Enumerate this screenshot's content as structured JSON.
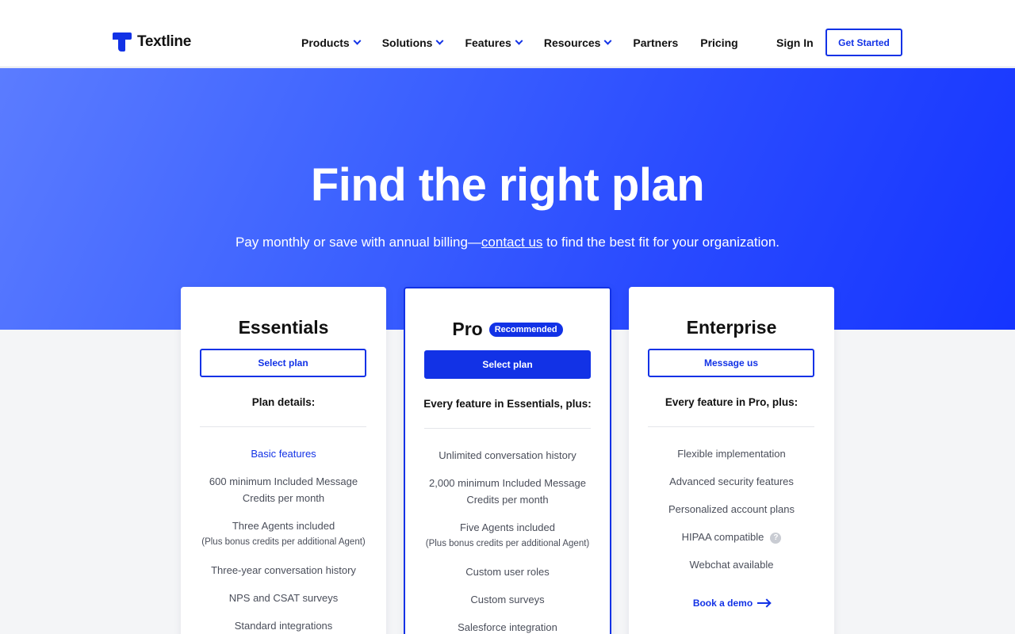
{
  "header": {
    "logo_text": "Textline",
    "nav": [
      {
        "label": "Products",
        "dropdown": true
      },
      {
        "label": "Solutions",
        "dropdown": true
      },
      {
        "label": "Features",
        "dropdown": true
      },
      {
        "label": "Resources",
        "dropdown": true
      },
      {
        "label": "Partners",
        "dropdown": false
      },
      {
        "label": "Pricing",
        "dropdown": false
      }
    ],
    "sign_in": "Sign In",
    "get_started": "Get Started"
  },
  "hero": {
    "title": "Find the right plan",
    "subtitle_before": "Pay monthly or save with annual billing—",
    "subtitle_link": "contact us",
    "subtitle_after": " to find the best fit for your organization."
  },
  "plans": {
    "essentials": {
      "name": "Essentials",
      "button": "Select plan",
      "details_head": "Plan details:",
      "features": [
        "Basic features",
        "600 minimum Included Message Credits per month",
        "Three Agents included",
        "(Plus bonus credits per additional Agent)",
        "Three-year conversation history",
        "NPS and CSAT surveys",
        "Standard integrations"
      ]
    },
    "pro": {
      "name": "Pro",
      "badge": "Recommended",
      "button": "Select plan",
      "details_head": "Every feature in Essentials, plus:",
      "features": [
        "Unlimited conversation history",
        "2,000 minimum Included Message Credits per month",
        "Five Agents included",
        "(Plus bonus credits per additional Agent)",
        "Custom user roles",
        "Custom surveys",
        "Salesforce integration"
      ]
    },
    "enterprise": {
      "name": "Enterprise",
      "button": "Message us",
      "details_head": "Every feature in Pro, plus:",
      "features": [
        "Flexible implementation",
        "Advanced security features",
        "Personalized account plans",
        "HIPAA compatible",
        "Webchat available"
      ],
      "help_glyph": "?",
      "demo_link": "Book a demo"
    }
  },
  "colors": {
    "brand": "#1232e6",
    "hero_start": "#5b7cff",
    "hero_end": "#1534ff"
  }
}
